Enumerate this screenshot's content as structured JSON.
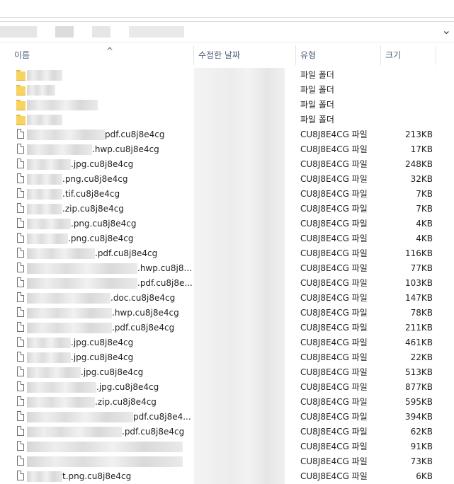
{
  "header": {
    "name_label": "이름",
    "date_label": "수정한 날짜",
    "type_label": "유형",
    "size_label": "크기",
    "sort_indicator": "^"
  },
  "files": [
    {
      "kind": "folder",
      "name": "",
      "type": "파일 폴더",
      "size": ""
    },
    {
      "kind": "folder",
      "name": "",
      "type": "파일 폴더",
      "size": ""
    },
    {
      "kind": "folder",
      "name": "",
      "type": "파일 폴더",
      "size": ""
    },
    {
      "kind": "folder",
      "name": "",
      "type": "파일 폴더",
      "size": ""
    },
    {
      "kind": "file",
      "name": "pdf.cu8j8e4cg",
      "type": "CU8J8E4CG 파일",
      "size": "213KB"
    },
    {
      "kind": "file",
      "name": ".hwp.cu8j8e4cg",
      "type": "CU8J8E4CG 파일",
      "size": "17KB"
    },
    {
      "kind": "file",
      "name": ".jpg.cu8j8e4cg",
      "type": "CU8J8E4CG 파일",
      "size": "248KB"
    },
    {
      "kind": "file",
      "name": ".png.cu8j8e4cg",
      "type": "CU8J8E4CG 파일",
      "size": "32KB"
    },
    {
      "kind": "file",
      "name": ".tif.cu8j8e4cg",
      "type": "CU8J8E4CG 파일",
      "size": "7KB"
    },
    {
      "kind": "file",
      "name": ".zip.cu8j8e4cg",
      "type": "CU8J8E4CG 파일",
      "size": "7KB"
    },
    {
      "kind": "file",
      "name": ".png.cu8j8e4cg",
      "type": "CU8J8E4CG 파일",
      "size": "4KB"
    },
    {
      "kind": "file",
      "name": ".png.cu8j8e4cg",
      "type": "CU8J8E4CG 파일",
      "size": "4KB"
    },
    {
      "kind": "file",
      "name": ".pdf.cu8j8e4cg",
      "type": "CU8J8E4CG 파일",
      "size": "116KB"
    },
    {
      "kind": "file",
      "name": ".hwp.cu8j8...",
      "type": "CU8J8E4CG 파일",
      "size": "77KB"
    },
    {
      "kind": "file",
      "name": ".pdf.cu8j8e...",
      "type": "CU8J8E4CG 파일",
      "size": "103KB"
    },
    {
      "kind": "file",
      "name": ".doc.cu8j8e4cg",
      "type": "CU8J8E4CG 파일",
      "size": "147KB"
    },
    {
      "kind": "file",
      "name": ".hwp.cu8j8e4cg",
      "type": "CU8J8E4CG 파일",
      "size": "78KB"
    },
    {
      "kind": "file",
      "name": ".pdf.cu8j8e4cg",
      "type": "CU8J8E4CG 파일",
      "size": "211KB"
    },
    {
      "kind": "file",
      "name": ".jpg.cu8j8e4cg",
      "type": "CU8J8E4CG 파일",
      "size": "461KB"
    },
    {
      "kind": "file",
      "name": ".jpg.cu8j8e4cg",
      "type": "CU8J8E4CG 파일",
      "size": "22KB"
    },
    {
      "kind": "file",
      "name": ".jpg.cu8j8e4cg",
      "type": "CU8J8E4CG 파일",
      "size": "513KB"
    },
    {
      "kind": "file",
      "name": ".jpg.cu8j8e4cg",
      "type": "CU8J8E4CG 파일",
      "size": "877KB"
    },
    {
      "kind": "file",
      "name": ".zip.cu8j8e4cg",
      "type": "CU8J8E4CG 파일",
      "size": "595KB"
    },
    {
      "kind": "file",
      "name": "pdf.cu8j8e4...",
      "type": "CU8J8E4CG 파일",
      "size": "394KB"
    },
    {
      "kind": "file",
      "name": ".pdf.cu8j8e4cg",
      "type": "CU8J8E4CG 파일",
      "size": "62KB"
    },
    {
      "kind": "file",
      "name": "",
      "type": "CU8J8E4CG 파일",
      "size": "91KB"
    },
    {
      "kind": "file",
      "name": "",
      "type": "CU8J8E4CG 파일",
      "size": "73KB"
    },
    {
      "kind": "file",
      "name": "t.png.cu8j8e4cg",
      "type": "CU8J8E4CG 파일",
      "size": "6KB"
    }
  ]
}
